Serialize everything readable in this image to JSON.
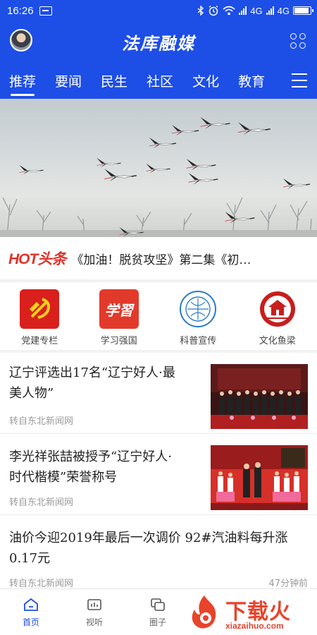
{
  "status_bar": {
    "time": "16:26",
    "network_1": "4G",
    "network_2": "4G",
    "battery_level": 0.9,
    "icons": [
      "message-icon",
      "bluetooth-icon",
      "alarm-icon",
      "wifi-icon",
      "signal-icon",
      "battery-icon"
    ]
  },
  "header": {
    "title": "法库融媒",
    "tabs": [
      {
        "label": "推荐",
        "active": true
      },
      {
        "label": "要闻"
      },
      {
        "label": "民生"
      },
      {
        "label": "社区"
      },
      {
        "label": "文化"
      },
      {
        "label": "教育"
      }
    ],
    "brand_color": "#1d4ee6"
  },
  "headline": {
    "logo_text": "HOT头条",
    "text": "《加油！脱贫攻坚》第二集《初…"
  },
  "quick_links": [
    {
      "label": "党建专栏",
      "icon": "party-emblem-icon",
      "color": "#d9201d"
    },
    {
      "label": "学习强国",
      "icon": "xuexi-icon",
      "color": "#e23a2a"
    },
    {
      "label": "科普宣传",
      "icon": "science-seal-icon",
      "color": "#2a7bc4"
    },
    {
      "label": "文化鱼梁",
      "icon": "pavilion-icon",
      "color": "#c81e1e"
    }
  ],
  "articles": [
    {
      "title_line1": "辽宁评选出17名“辽宁好人·最",
      "title_line2": "美人物”",
      "source": "转自东北新闻网"
    },
    {
      "title_line1": "李光祥张喆被授予“辽宁好人·",
      "title_line2": "时代楷模”荣誉称号",
      "source": "转自东北新闻网"
    },
    {
      "title_line1": "油价今迎2019年最后一次调价 92#汽油料每升涨",
      "title_line2": "0.17元",
      "source": "转自东北新闻网",
      "time": "47分钟前"
    }
  ],
  "bottom_nav": [
    {
      "label": "首页",
      "icon": "home-icon",
      "active": true
    },
    {
      "label": "视听",
      "icon": "video-icon"
    },
    {
      "label": "圈子",
      "icon": "circle-icon"
    }
  ],
  "watermark": {
    "text": "下载火",
    "domain": "xiazaihuo.com"
  }
}
